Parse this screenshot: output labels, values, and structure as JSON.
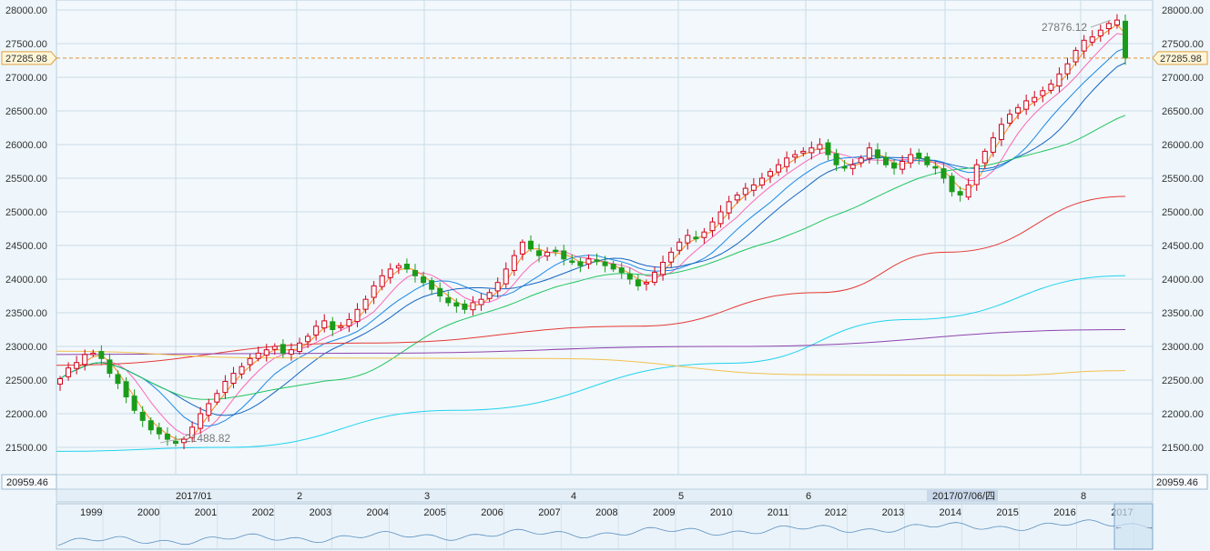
{
  "chart_data": {
    "type": "candlestick",
    "y_axis": {
      "ylim": [
        21430,
        28020
      ],
      "ticks": [
        "28000.00",
        "27500.00",
        "27000.00",
        "26500.00",
        "26000.00",
        "25500.00",
        "25000.00",
        "24500.00",
        "24000.00",
        "23500.00",
        "23000.00",
        "22500.00",
        "22000.00",
        "21500.00"
      ],
      "tick_values": [
        28000,
        27500,
        27000,
        26500,
        26000,
        25500,
        25000,
        24500,
        24000,
        23500,
        23000,
        22500,
        22000,
        21500
      ]
    },
    "current_price": 27285.98,
    "current_price_label": "27285.98",
    "bottom_value_label": "20959.46",
    "high_annotation": {
      "label": "27876.12",
      "value": 27876.12
    },
    "low_annotation": {
      "label": "21488.82",
      "value": 21488.82
    },
    "x_labels": [
      "2017/01",
      "2",
      "3",
      "4",
      "5",
      "6",
      "2017/07/06/四",
      "8"
    ],
    "highlighted_date": "2017/07/06/四",
    "navigator_years": [
      "1999",
      "2000",
      "2001",
      "2002",
      "2003",
      "2004",
      "2005",
      "2006",
      "2007",
      "2008",
      "2009",
      "2010",
      "2011",
      "2012",
      "2013",
      "2014",
      "2015",
      "2016",
      "2017"
    ],
    "candles_close": [
      22520,
      22680,
      22760,
      22880,
      22900,
      22820,
      22600,
      22450,
      22250,
      22050,
      21900,
      21760,
      21700,
      21620,
      21560,
      21620,
      21800,
      22000,
      22150,
      22300,
      22480,
      22600,
      22700,
      22820,
      22900,
      22950,
      23000,
      22900,
      22950,
      23050,
      23150,
      23300,
      23380,
      23250,
      23300,
      23400,
      23550,
      23700,
      23900,
      24050,
      24150,
      24200,
      24150,
      24050,
      23950,
      23850,
      23750,
      23650,
      23600,
      23550,
      23650,
      23700,
      23800,
      23950,
      24150,
      24350,
      24550,
      24450,
      24350,
      24400,
      24420,
      24300,
      24250,
      24200,
      24300,
      24280,
      24200,
      24150,
      24100,
      24000,
      23900,
      23950,
      24100,
      24250,
      24400,
      24550,
      24650,
      24600,
      24700,
      24850,
      25000,
      25150,
      25250,
      25350,
      25400,
      25500,
      25600,
      25700,
      25800,
      25850,
      25900,
      25950,
      26000,
      25850,
      25700,
      25650,
      25700,
      25800,
      25950,
      25800,
      25700,
      25650,
      25750,
      25850,
      25800,
      25700,
      25650,
      25500,
      25300,
      25250,
      25400,
      25700,
      25900,
      26100,
      26300,
      26450,
      26550,
      26650,
      26700,
      26800,
      26900,
      27050,
      27200,
      27400,
      27550,
      27600,
      27700,
      27800,
      27850,
      27285.98
    ],
    "moving_averages": [
      {
        "name": "MA5",
        "color": "#ff8c1a"
      },
      {
        "name": "MA10",
        "color": "#ff66b3"
      },
      {
        "name": "MA20",
        "color": "#1e88e5"
      },
      {
        "name": "MA30",
        "color": "#1565c0"
      },
      {
        "name": "MA60",
        "color": "#22c55e"
      },
      {
        "name": "MA120",
        "color": "#e53935"
      },
      {
        "name": "MA250",
        "color": "#22d3ee"
      },
      {
        "name": "MA500",
        "color": "#8e44ad"
      },
      {
        "name": "MA1000",
        "color": "#f2c14e"
      }
    ],
    "colors": {
      "up": "#d0021b",
      "down": "#1a9c1a",
      "grid": "#c9dbe8"
    }
  }
}
